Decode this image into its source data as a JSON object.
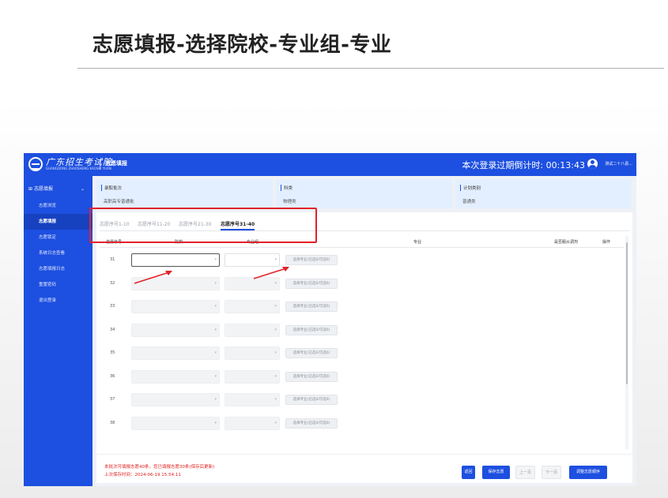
{
  "slide": {
    "title": "志愿填报-选择院校-专业组-专业"
  },
  "app": {
    "logo_text": "广东招生考试院",
    "logo_sub": "GUANGDONG ZHAOSHENG KAOSHI YUAN",
    "section_title": "志愿填报",
    "countdown": "本次登录过期倒计时: 00:13:43",
    "user_name": "测试二十八县..."
  },
  "sidebar": {
    "group_label": "志愿填报",
    "items": [
      {
        "label": "志愿浏览",
        "active": false
      },
      {
        "label": "志愿填报",
        "active": true
      },
      {
        "label": "志愿锁定",
        "active": false
      },
      {
        "label": "系统日志查看",
        "active": false
      },
      {
        "label": "志愿填报日志",
        "active": false
      },
      {
        "label": "重置密码",
        "active": false
      },
      {
        "label": "退出登录",
        "active": false
      }
    ]
  },
  "info_cards": [
    {
      "title": "录取批次",
      "value": "高职高专普通批"
    },
    {
      "title": "科类",
      "value": "物理类"
    },
    {
      "title": "计划类别",
      "value": "普通类"
    }
  ],
  "tabs": [
    {
      "label": "志愿序号1-10",
      "active": false
    },
    {
      "label": "志愿序号11-20",
      "active": false
    },
    {
      "label": "志愿序号21-30",
      "active": false
    },
    {
      "label": "志愿序号31-40",
      "active": true
    }
  ],
  "table": {
    "headers": {
      "index": "志愿序号",
      "school": "院校",
      "group": "专业组",
      "major": "专业",
      "adjust": "是否服从调剂",
      "action": "操作"
    },
    "pick_label": "选择专业(已选0/可选6)",
    "rows": [
      "31",
      "32",
      "33",
      "34",
      "35",
      "36",
      "37",
      "38"
    ]
  },
  "footer": {
    "note": "本批次可填报志愿40条，您已填报志愿30条(保存后更新)",
    "saved": "上次保存时间：2024-06-19 15:54:11",
    "buttons": {
      "back": "返回",
      "save": "保存志愿",
      "prev": "上一页",
      "next": "下一页",
      "reorder": "调整志愿顺序"
    }
  },
  "colors": {
    "brand": "#1d4fe0",
    "annotation": "#e2222a"
  }
}
